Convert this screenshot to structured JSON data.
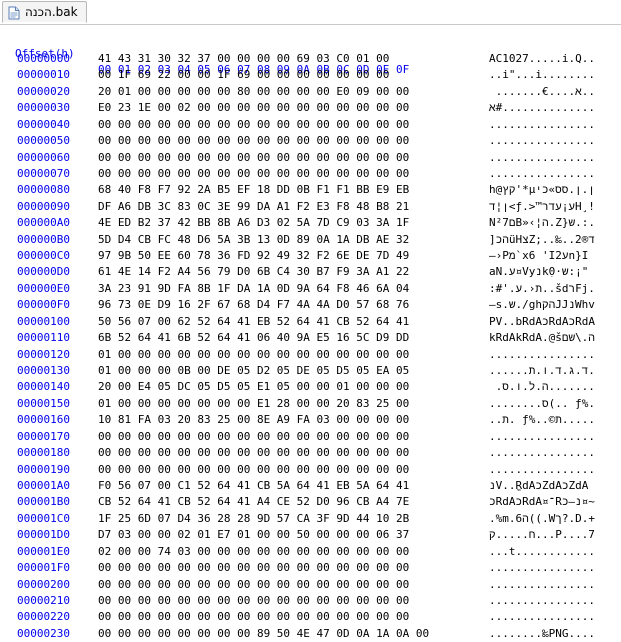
{
  "tab": {
    "title": "הכנה.bak",
    "icon": "document-icon"
  },
  "header": {
    "offset_label": "Offset(h)",
    "columns": "00 01 02 03 04 05 06 07 08 09 0A 0B 0C 0D 0E 0F"
  },
  "rows": [
    {
      "offset": "00000000",
      "hex": "41 43 31 30 32 37 00 00 00 00 69 03 C0 01 00",
      "ascii": "AC1027.....i.Q.."
    },
    {
      "offset": "00000010",
      "hex": "00 1F 69 22 00 00 1F 69 00 00 00 00 00 00 00",
      "ascii": "..i\"...i........"
    },
    {
      "offset": "00000020",
      "hex": "20 01 00 00 00 00 00 80 00 00 00 00 E0 09 00 00",
      "ascii": " .......€....א.."
    },
    {
      "offset": "00000030",
      "hex": "E0 23 1E 00 02 00 00 00 00 00 00 00 00 00 00 00",
      "ascii": "א#.............."
    },
    {
      "offset": "00000040",
      "hex": "00 00 00 00 00 00 00 00 00 00 00 00 00 00 00 00",
      "ascii": "................"
    },
    {
      "offset": "00000050",
      "hex": "00 00 00 00 00 00 00 00 00 00 00 00 00 00 00 00",
      "ascii": "................"
    },
    {
      "offset": "00000060",
      "hex": "00 00 00 00 00 00 00 00 00 00 00 00 00 00 00 00",
      "ascii": "................"
    },
    {
      "offset": "00000070",
      "hex": "00 00 00 00 00 00 00 00 00 00 00 00 00 00 00 00",
      "ascii": "................"
    },
    {
      "offset": "00000080",
      "hex": "68 40 F8 F7 92 2A B5 EF 18 DD 0B F1 F1 BB E9 EB",
      "ascii": "h@קץ'*µן.ן.סס»כי"
    },
    {
      "offset": "00000090",
      "hex": "DF A6 DB 3C 83 0C 3E 99 DA A1 F2 E3 F8 48 B8 21",
      "ascii": "ן¦ד<ƒ.>™ע¡עדרH¸!"
    },
    {
      "offset": "000000A0",
      "hex": "4E ED B2 37 42 BB 8B A6 D3 02 5A 7D C9 03 3A 1F",
      "ascii": "Nם²7B»‹¦ה.Z}ש.:."
    },
    {
      "offset": "000000B0",
      "hex": "5D D4 CB FC 48 D6 5A 3B 13 0D 89 0A 1A DB AE 32",
      "ascii": "]הכüHצZ;..‰..ד®2"
    },
    {
      "offset": "000000C0",
      "hex": "97 9B 50 EE 60 78 36 FD 92 49 32 F2 6E DE 7D 49",
      "ascii": "—›Pמ`x6 'I2עn}I"
    },
    {
      "offset": "000000D0",
      "hex": "61 4E 14 F2 A4 56 79 D0 6B C4 30 B7 F9 3A A1 22",
      "ascii": "aN.ע¤Vyנkִ0·ש:¡\""
    },
    {
      "offset": "000000E0",
      "hex": "3A 23 91 9D FA 8B 1F DA 1A 0D 9A 64 F8 46 6A 04",
      "ascii": ":#'.ת‹.ע..šdרFj."
    },
    {
      "offset": "000000F0",
      "hex": "96 73 0E D9 16 2F 67 68 D4 F7 4A 4A D0 57 68 76",
      "ascii": "–s.ש./ghהקJJנWhv"
    },
    {
      "offset": "00000100",
      "hex": "50 56 07 00 62 52 64 41 EB 52 64 41 CB 52 64 41",
      "ascii": "PV..bRdAכRdAכRdA"
    },
    {
      "offset": "00000110",
      "hex": "6B 52 64 41 6B 52 64 41 06 40 9A E5 16 5C D9 DD",
      "ascii": "kRdAkRdA.@šה.\\שם"
    },
    {
      "offset": "00000120",
      "hex": "01 00 00 00 00 00 00 00 00 00 00 00 00 00 00 00",
      "ascii": "................"
    },
    {
      "offset": "00000130",
      "hex": "01 00 00 00 0B 00 DE 05 D2 05 DE 05 D5 05 EA 05",
      "ascii": "......ד.ג.ד.ו.ת."
    },
    {
      "offset": "00000140",
      "hex": "20 00 E4 05 DC 05 D5 05 E1 05 00 00 01 00 00 00",
      "ascii": " .ה.ל.ו.ס......."
    },
    {
      "offset": "00000150",
      "hex": "01 00 00 00 00 00 00 00 E1 28 00 00 20 83 25 00",
      "ascii": "........ס(.. ƒ%."
    },
    {
      "offset": "00000160",
      "hex": "10 81 FA 03 20 83 25 00 8E A9 FA 03 00 00 00 00",
      "ascii": "..ת. ƒ%..©ת....."
    },
    {
      "offset": "00000170",
      "hex": "00 00 00 00 00 00 00 00 00 00 00 00 00 00 00 00",
      "ascii": "................"
    },
    {
      "offset": "00000180",
      "hex": "00 00 00 00 00 00 00 00 00 00 00 00 00 00 00 00",
      "ascii": "................"
    },
    {
      "offset": "00000190",
      "hex": "00 00 00 00 00 00 00 00 00 00 00 00 00 00 00 00",
      "ascii": "................"
    },
    {
      "offset": "000001A0",
      "hex": "F0 56 07 00 C1 52 64 41 CB 5A 64 41 EB 5A 64 41",
      "ascii": "נV..ֱRdAכZdAכZdA"
    },
    {
      "offset": "000001B0",
      "hex": "CB 52 64 41 CB 52 64 41 A4 CE 52 D0 96 CB A4 7E",
      "ascii": "כRdAכRdA¤־Rנ–כ¤~"
    },
    {
      "offset": "000001C0",
      "hex": "1F 25 6D 07 D4 36 28 28 9D 57 CA 3F 9D 44 10 2B",
      "ascii": ".%m.ה6((.Wך?.D.+"
    },
    {
      "offset": "000001D0",
      "hex": "D7 03 00 00 02 01 E7 01 00 00 50 00 00 00 06 37",
      "ascii": "ח.....ק...P....7"
    },
    {
      "offset": "000001E0",
      "hex": "02 00 00 74 03 00 00 00 00 00 00 00 00 00 00 00",
      "ascii": "...t............"
    },
    {
      "offset": "000001F0",
      "hex": "00 00 00 00 00 00 00 00 00 00 00 00 00 00 00 00",
      "ascii": "................"
    },
    {
      "offset": "00000200",
      "hex": "00 00 00 00 00 00 00 00 00 00 00 00 00 00 00 00",
      "ascii": "................"
    },
    {
      "offset": "00000210",
      "hex": "00 00 00 00 00 00 00 00 00 00 00 00 00 00 00 00",
      "ascii": "................"
    },
    {
      "offset": "00000220",
      "hex": "00 00 00 00 00 00 00 00 00 00 00 00 00 00 00 00",
      "ascii": "................"
    },
    {
      "offset": "00000230",
      "hex": "00 00 00 00 00 00 00 00 89 50 4E 47 0D 0A 1A 0A 00",
      "ascii": "........‰PNG...."
    }
  ]
}
